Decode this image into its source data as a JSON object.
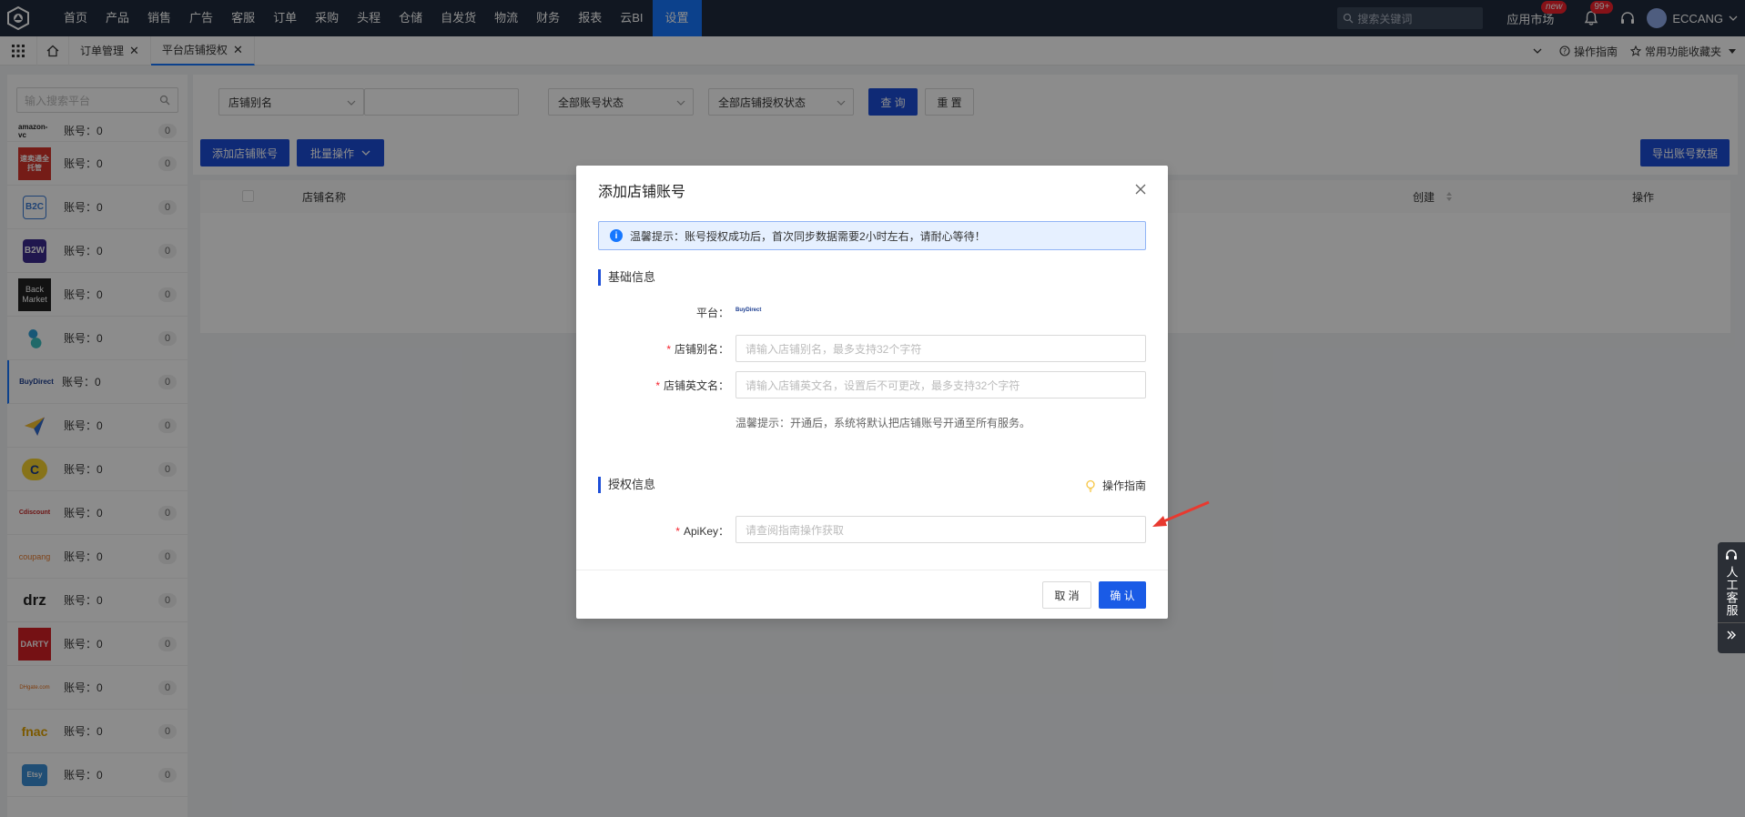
{
  "nav": {
    "items": [
      "首页",
      "产品",
      "销售",
      "广告",
      "客服",
      "订单",
      "采购",
      "头程",
      "仓储",
      "自发货",
      "物流",
      "财务",
      "报表",
      "云BI",
      "设置"
    ],
    "active_index": 14,
    "search_placeholder": "搜索关键词",
    "app_market": "应用市场",
    "app_market_badge": "new",
    "notify_badge": "99+",
    "user": "ECCANG"
  },
  "tabs": {
    "items": [
      {
        "label": "订单管理"
      },
      {
        "label": "平台店铺授权"
      }
    ],
    "right_guide": "操作指南",
    "right_fav": "常用功能收藏夹"
  },
  "sidebar": {
    "search_placeholder": "输入搜索平台",
    "items": [
      {
        "logo": "amazon-vc",
        "label": "账号：0",
        "count": "0"
      },
      {
        "logo": "速卖通全托管",
        "label": "账号：0",
        "count": "0"
      },
      {
        "logo": "B2C",
        "label": "账号：0",
        "count": "0"
      },
      {
        "logo": "B2W",
        "label": "账号：0",
        "count": "0"
      },
      {
        "logo": "Back Market",
        "label": "账号：0",
        "count": "0"
      },
      {
        "logo": "",
        "label": "账号：0",
        "count": "0"
      },
      {
        "logo": "BuyDirect",
        "label": "账号：0",
        "count": "0"
      },
      {
        "logo": "",
        "label": "账号：0",
        "count": "0"
      },
      {
        "logo": "C",
        "label": "账号：0",
        "count": "0"
      },
      {
        "logo": "Cdiscount",
        "label": "账号：0",
        "count": "0"
      },
      {
        "logo": "coupang",
        "label": "账号：0",
        "count": "0"
      },
      {
        "logo": "drz",
        "label": "账号：0",
        "count": "0"
      },
      {
        "logo": "DARTY",
        "label": "账号：0",
        "count": "0"
      },
      {
        "logo": "DHgate.com",
        "label": "账号：0",
        "count": "0"
      },
      {
        "logo": "fnac",
        "label": "账号：0",
        "count": "0"
      },
      {
        "logo": "Etsy",
        "label": "账号：0",
        "count": "0"
      }
    ]
  },
  "filters": {
    "alias_select": "店铺别名",
    "account_status": "全部账号状态",
    "auth_status": "全部店铺授权状态",
    "query": "查 询",
    "reset": "重 置"
  },
  "toolbar": {
    "add": "添加店铺账号",
    "batch": "批量操作",
    "export": "导出账号数据"
  },
  "table": {
    "columns": [
      "店铺名称",
      "创建",
      "操作"
    ]
  },
  "modal": {
    "title": "添加店铺账号",
    "alert": "温馨提示：账号授权成功后，首次同步数据需要2小时左右，请耐心等待！",
    "basic_section": "基础信息",
    "platform_label": "平台：",
    "platform_value": "BuyDirect",
    "alias_label": "店铺别名：",
    "alias_placeholder": "请输入店铺别名，最多支持32个字符",
    "en_name_label": "店铺英文名：",
    "en_name_placeholder": "请输入店铺英文名，设置后不可更改，最多支持32个字符",
    "tip": "温馨提示：开通后，系统将默认把店铺账号开通至所有服务。",
    "auth_section": "授权信息",
    "guide": "操作指南",
    "apikey_label": "ApiKey：",
    "apikey_placeholder": "请查阅指南操作获取",
    "cancel": "取 消",
    "confirm": "确 认"
  },
  "float_service": {
    "label": "人工客服"
  },
  "colors": {
    "nav_bg": "#1f2a3c",
    "primary": "#1d4ed8",
    "active_nav": "#1677ff",
    "danger": "#f5222d"
  }
}
